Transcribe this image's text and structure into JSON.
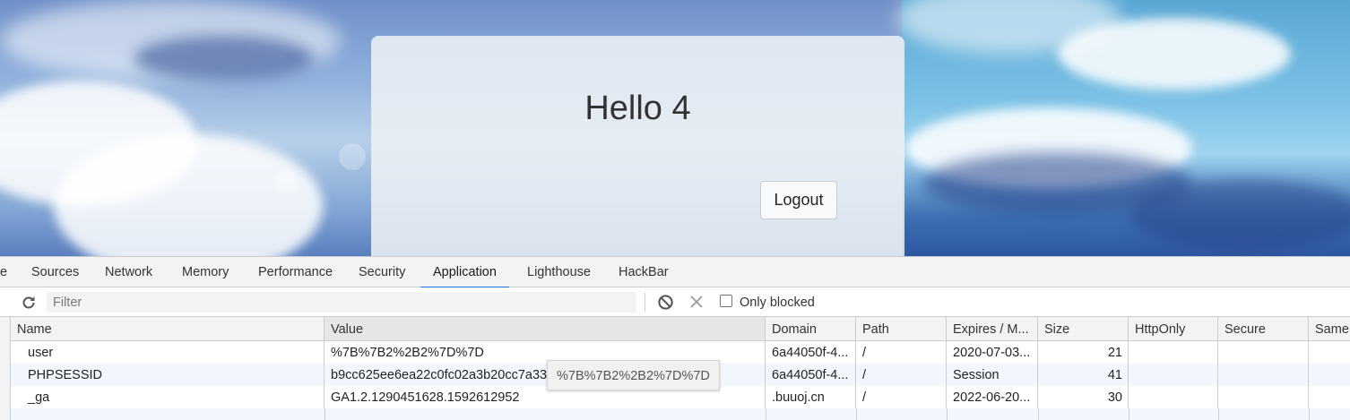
{
  "page": {
    "greeting": "Hello 4",
    "logout_label": "Logout"
  },
  "devtools": {
    "tabs": [
      {
        "label": "e"
      },
      {
        "label": "Sources"
      },
      {
        "label": "Network"
      },
      {
        "label": "Memory"
      },
      {
        "label": "Performance"
      },
      {
        "label": "Security"
      },
      {
        "label": "Application",
        "active": true
      },
      {
        "label": "Lighthouse"
      },
      {
        "label": "HackBar"
      }
    ],
    "toolbar": {
      "filter_placeholder": "Filter",
      "only_blocked_label": "Only blocked",
      "only_blocked_checked": false
    },
    "cookies": {
      "columns": [
        "Name",
        "Value",
        "Domain",
        "Path",
        "Expires / M...",
        "Size",
        "HttpOnly",
        "Secure",
        "SameS"
      ],
      "rows": [
        {
          "name": "user",
          "value": "%7B%7B2%2B2%7D%7D",
          "domain": "6a44050f-4...",
          "path": "/",
          "expires": "2020-07-03...",
          "size": "21"
        },
        {
          "name": "PHPSESSID",
          "value": "b9cc625ee6ea22c0fc02a3b20cc7a338",
          "domain": "6a44050f-4...",
          "path": "/",
          "expires": "Session",
          "size": "41"
        },
        {
          "name": "_ga",
          "value": "GA1.2.1290451628.1592612952",
          "domain": ".buuoj.cn",
          "path": "/",
          "expires": "2022-06-20...",
          "size": "30"
        }
      ]
    },
    "tooltip": "%7B%7B2%2B2%7D%7D"
  }
}
